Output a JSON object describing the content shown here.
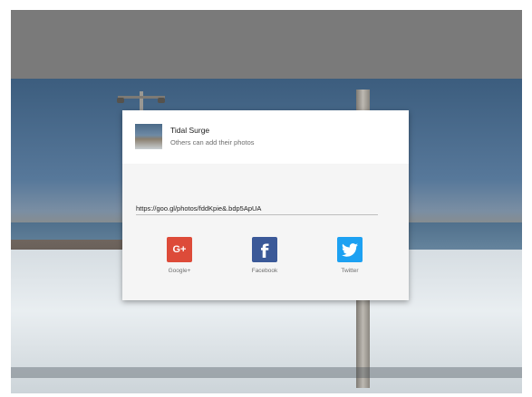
{
  "dialog": {
    "album_title": "Tidal Surge",
    "album_subtitle": "Others can add their photos",
    "share_link": "https://goo.gl/photos/fddKpie&.bdp5ApUA",
    "share_options": [
      {
        "label": "Google+",
        "icon": "google-plus-icon",
        "glyph": "G+"
      },
      {
        "label": "Facebook",
        "icon": "facebook-icon",
        "glyph": "f"
      },
      {
        "label": "Twitter",
        "icon": "twitter-icon",
        "glyph": ""
      }
    ]
  },
  "colors": {
    "google_plus": "#dd4b39",
    "facebook": "#3b5998",
    "twitter": "#1da1f2",
    "overlay": "#7a7a7a"
  }
}
